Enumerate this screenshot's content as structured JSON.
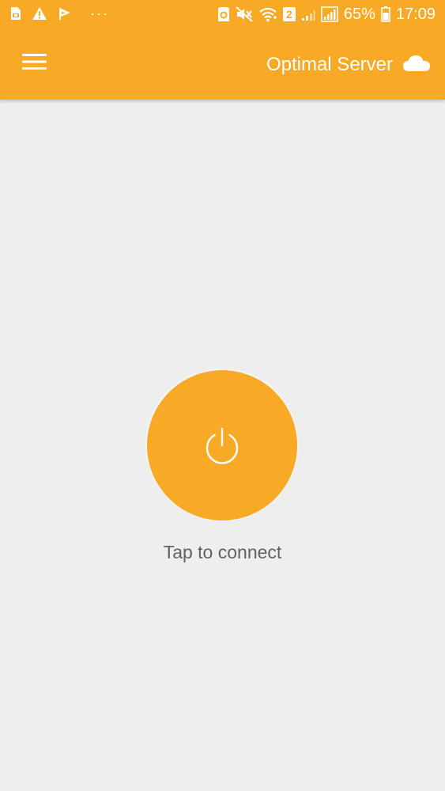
{
  "status_bar": {
    "icons_left": [
      "sim-card-icon",
      "warning-icon",
      "sync-flag-icon",
      "more-notifications-icon"
    ],
    "more_indicator": "···",
    "icons_right": [
      "nfc-icon",
      "mute-vibrate-icon",
      "wifi-icon",
      "sim-2-badge-icon",
      "signal-weak-icon",
      "signal-icon"
    ],
    "sim_badge": "2",
    "battery_percent": "65%",
    "time": "17:09"
  },
  "app_bar": {
    "menu_icon": "hamburger-menu-icon",
    "server_label": "Optimal Server",
    "server_icon": "cloud-icon",
    "background_color": "#f8a925",
    "text_color": "#ffffff"
  },
  "main": {
    "power_button_icon": "power-icon",
    "power_button_color": "#f8a925",
    "status_text": "Tap to connect",
    "background_color": "#eeeeee"
  }
}
